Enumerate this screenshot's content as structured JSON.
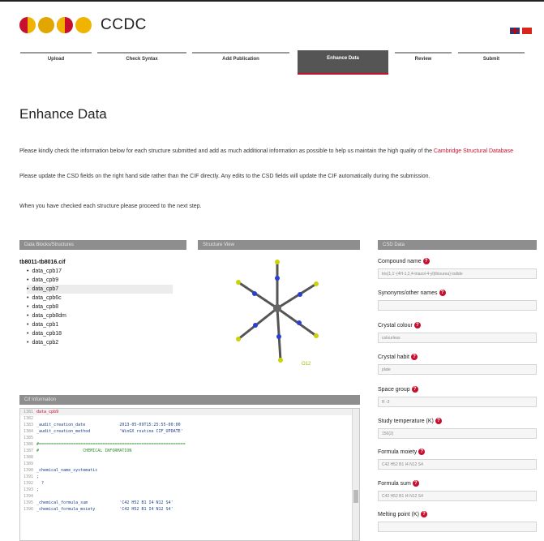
{
  "header": {
    "brand": "CCDC",
    "flags": [
      "uk-flag-icon",
      "china-flag-icon"
    ]
  },
  "steps": [
    {
      "label": "Upload",
      "active": false
    },
    {
      "label": "Check Syntax",
      "active": false
    },
    {
      "label": "Add Publication",
      "active": false
    },
    {
      "label": "Enhance Data",
      "active": true
    },
    {
      "label": "Review",
      "active": false
    },
    {
      "label": "Submit",
      "active": false
    }
  ],
  "page": {
    "title": "Enhance Data",
    "para1": "Please kindly check the information below for each structure submitted and add as much additional information as possible to help us maintain the high quality of the",
    "para1_link": "Cambridge Structural Database",
    "para2": "Please update the CSD fields on the right hand side rather than the CIF directly. Any edits to the CSD fields will update the CIF automatically during the submission.",
    "para3": "When you have checked each structure please proceed to the next step."
  },
  "structures_panel": {
    "heading": "Data Blocks/Structures",
    "file": "tb8011-tb8016.cif",
    "items": [
      "data_cpb17",
      "data_cpb9",
      "data_cpb7",
      "data_cpb6c",
      "data_cpb8",
      "data_cpb8dm",
      "data_cpb1",
      "data_cpb18",
      "data_cpb2"
    ]
  },
  "viewer_panel": {
    "heading": "Structure View",
    "atom_label": "O12"
  },
  "cif_panel": {
    "heading": "Cif Information",
    "lines": [
      {
        "num": "1381",
        "text": "data_cpb9",
        "style": "red"
      },
      {
        "num": "1382",
        "text": "",
        "style": ""
      },
      {
        "num": "1383",
        "text": "_audit_creation_date              2013-05-09T15:25:55-00:00",
        "style": ""
      },
      {
        "num": "1384",
        "text": "_audit_creation_method            'WinGX routine CIF_UPDATE'",
        "style": ""
      },
      {
        "num": "1385",
        "text": "",
        "style": ""
      },
      {
        "num": "1386",
        "text": "#============================================================",
        "style": "green"
      },
      {
        "num": "1387",
        "text": "#                  CHEMICAL INFORMATION",
        "style": "green"
      },
      {
        "num": "1388",
        "text": "",
        "style": ""
      },
      {
        "num": "1389",
        "text": "",
        "style": ""
      },
      {
        "num": "1390",
        "text": "_chemical_name_systematic",
        "style": ""
      },
      {
        "num": "1391",
        "text": ";",
        "style": ""
      },
      {
        "num": "1392",
        "text": "  ?",
        "style": ""
      },
      {
        "num": "1393",
        "text": ";",
        "style": ""
      },
      {
        "num": "1394",
        "text": "",
        "style": ""
      },
      {
        "num": "1395",
        "text": "_chemical_formula_sum             'C42 H52 B1 I4 N12 S4'",
        "style": ""
      },
      {
        "num": "1396",
        "text": "_chemical_formula_moiety          'C42 H52 B1 I4 N12 S4'",
        "style": ""
      }
    ]
  },
  "csd_panel": {
    "heading": "CSD Data",
    "fields": [
      {
        "label": "Compound name",
        "value": "tris(1,1'-(4H-1,2,4-triazol-4-yl)thiourea) iodide"
      },
      {
        "label": "Synonyms/other names",
        "value": ""
      },
      {
        "label": "Crystal colour",
        "value": "colourless"
      },
      {
        "label": "Crystal habit",
        "value": "plate"
      },
      {
        "label": "Space group",
        "value": "R -3"
      },
      {
        "label": "Study temperature (K)",
        "value": "150(2)"
      },
      {
        "label": "Formula moiety",
        "value": "C42 H52 B1 I4 N12 S4"
      },
      {
        "label": "Formula sum",
        "value": "C42 H52 B1 I4 N12 S4"
      },
      {
        "label": "Melting point (K)",
        "value": ""
      }
    ]
  }
}
